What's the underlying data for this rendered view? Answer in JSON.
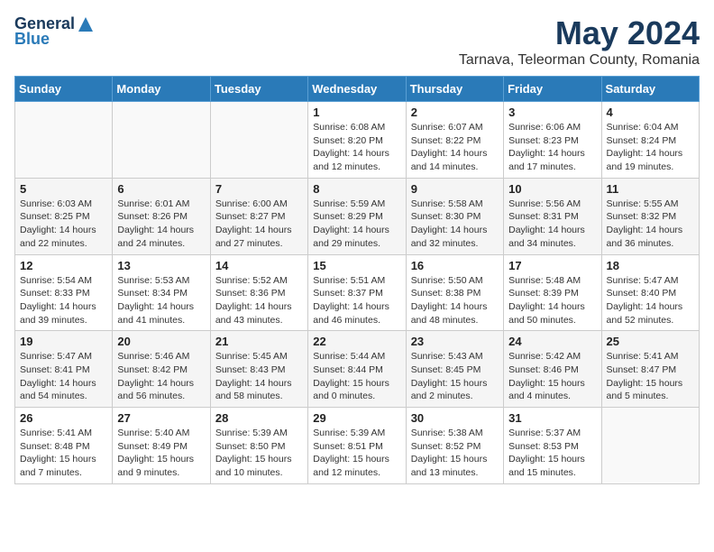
{
  "header": {
    "logo_general": "General",
    "logo_blue": "Blue",
    "month_year": "May 2024",
    "location": "Tarnava, Teleorman County, Romania"
  },
  "days_of_week": [
    "Sunday",
    "Monday",
    "Tuesday",
    "Wednesday",
    "Thursday",
    "Friday",
    "Saturday"
  ],
  "weeks": [
    {
      "cells": [
        {
          "day": null,
          "info": null
        },
        {
          "day": null,
          "info": null
        },
        {
          "day": null,
          "info": null
        },
        {
          "day": "1",
          "info": "Sunrise: 6:08 AM\nSunset: 8:20 PM\nDaylight: 14 hours\nand 12 minutes."
        },
        {
          "day": "2",
          "info": "Sunrise: 6:07 AM\nSunset: 8:22 PM\nDaylight: 14 hours\nand 14 minutes."
        },
        {
          "day": "3",
          "info": "Sunrise: 6:06 AM\nSunset: 8:23 PM\nDaylight: 14 hours\nand 17 minutes."
        },
        {
          "day": "4",
          "info": "Sunrise: 6:04 AM\nSunset: 8:24 PM\nDaylight: 14 hours\nand 19 minutes."
        }
      ]
    },
    {
      "cells": [
        {
          "day": "5",
          "info": "Sunrise: 6:03 AM\nSunset: 8:25 PM\nDaylight: 14 hours\nand 22 minutes."
        },
        {
          "day": "6",
          "info": "Sunrise: 6:01 AM\nSunset: 8:26 PM\nDaylight: 14 hours\nand 24 minutes."
        },
        {
          "day": "7",
          "info": "Sunrise: 6:00 AM\nSunset: 8:27 PM\nDaylight: 14 hours\nand 27 minutes."
        },
        {
          "day": "8",
          "info": "Sunrise: 5:59 AM\nSunset: 8:29 PM\nDaylight: 14 hours\nand 29 minutes."
        },
        {
          "day": "9",
          "info": "Sunrise: 5:58 AM\nSunset: 8:30 PM\nDaylight: 14 hours\nand 32 minutes."
        },
        {
          "day": "10",
          "info": "Sunrise: 5:56 AM\nSunset: 8:31 PM\nDaylight: 14 hours\nand 34 minutes."
        },
        {
          "day": "11",
          "info": "Sunrise: 5:55 AM\nSunset: 8:32 PM\nDaylight: 14 hours\nand 36 minutes."
        }
      ]
    },
    {
      "cells": [
        {
          "day": "12",
          "info": "Sunrise: 5:54 AM\nSunset: 8:33 PM\nDaylight: 14 hours\nand 39 minutes."
        },
        {
          "day": "13",
          "info": "Sunrise: 5:53 AM\nSunset: 8:34 PM\nDaylight: 14 hours\nand 41 minutes."
        },
        {
          "day": "14",
          "info": "Sunrise: 5:52 AM\nSunset: 8:36 PM\nDaylight: 14 hours\nand 43 minutes."
        },
        {
          "day": "15",
          "info": "Sunrise: 5:51 AM\nSunset: 8:37 PM\nDaylight: 14 hours\nand 46 minutes."
        },
        {
          "day": "16",
          "info": "Sunrise: 5:50 AM\nSunset: 8:38 PM\nDaylight: 14 hours\nand 48 minutes."
        },
        {
          "day": "17",
          "info": "Sunrise: 5:48 AM\nSunset: 8:39 PM\nDaylight: 14 hours\nand 50 minutes."
        },
        {
          "day": "18",
          "info": "Sunrise: 5:47 AM\nSunset: 8:40 PM\nDaylight: 14 hours\nand 52 minutes."
        }
      ]
    },
    {
      "cells": [
        {
          "day": "19",
          "info": "Sunrise: 5:47 AM\nSunset: 8:41 PM\nDaylight: 14 hours\nand 54 minutes."
        },
        {
          "day": "20",
          "info": "Sunrise: 5:46 AM\nSunset: 8:42 PM\nDaylight: 14 hours\nand 56 minutes."
        },
        {
          "day": "21",
          "info": "Sunrise: 5:45 AM\nSunset: 8:43 PM\nDaylight: 14 hours\nand 58 minutes."
        },
        {
          "day": "22",
          "info": "Sunrise: 5:44 AM\nSunset: 8:44 PM\nDaylight: 15 hours\nand 0 minutes."
        },
        {
          "day": "23",
          "info": "Sunrise: 5:43 AM\nSunset: 8:45 PM\nDaylight: 15 hours\nand 2 minutes."
        },
        {
          "day": "24",
          "info": "Sunrise: 5:42 AM\nSunset: 8:46 PM\nDaylight: 15 hours\nand 4 minutes."
        },
        {
          "day": "25",
          "info": "Sunrise: 5:41 AM\nSunset: 8:47 PM\nDaylight: 15 hours\nand 5 minutes."
        }
      ]
    },
    {
      "cells": [
        {
          "day": "26",
          "info": "Sunrise: 5:41 AM\nSunset: 8:48 PM\nDaylight: 15 hours\nand 7 minutes."
        },
        {
          "day": "27",
          "info": "Sunrise: 5:40 AM\nSunset: 8:49 PM\nDaylight: 15 hours\nand 9 minutes."
        },
        {
          "day": "28",
          "info": "Sunrise: 5:39 AM\nSunset: 8:50 PM\nDaylight: 15 hours\nand 10 minutes."
        },
        {
          "day": "29",
          "info": "Sunrise: 5:39 AM\nSunset: 8:51 PM\nDaylight: 15 hours\nand 12 minutes."
        },
        {
          "day": "30",
          "info": "Sunrise: 5:38 AM\nSunset: 8:52 PM\nDaylight: 15 hours\nand 13 minutes."
        },
        {
          "day": "31",
          "info": "Sunrise: 5:37 AM\nSunset: 8:53 PM\nDaylight: 15 hours\nand 15 minutes."
        },
        {
          "day": null,
          "info": null
        }
      ]
    }
  ]
}
